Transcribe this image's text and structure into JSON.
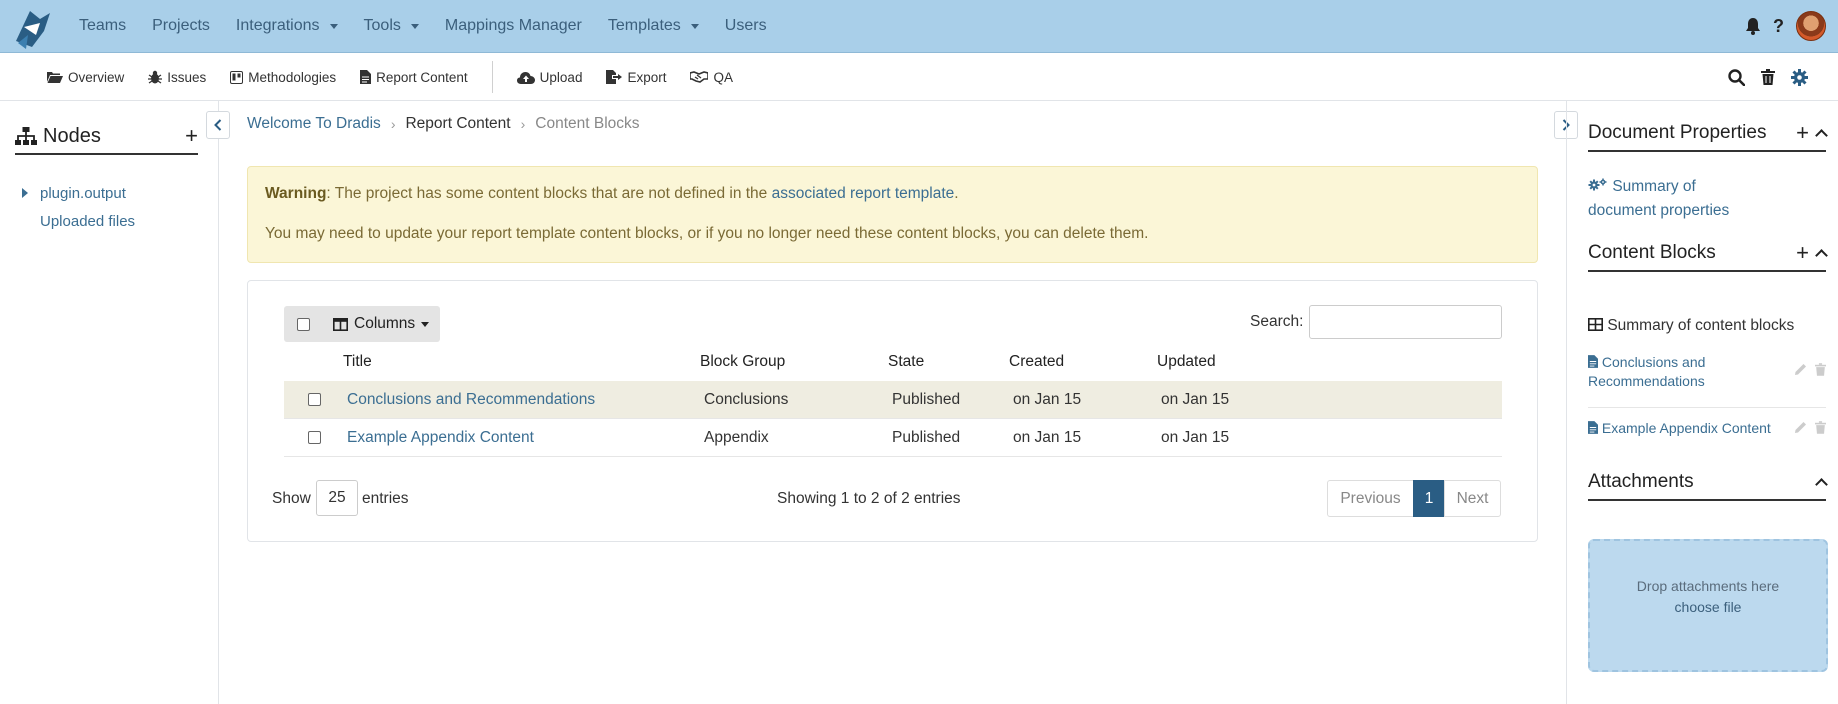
{
  "topnav": {
    "items": [
      {
        "label": "Teams",
        "dropdown": false
      },
      {
        "label": "Projects",
        "dropdown": false
      },
      {
        "label": "Integrations",
        "dropdown": true
      },
      {
        "label": "Tools",
        "dropdown": true
      },
      {
        "label": "Mappings Manager",
        "dropdown": false
      },
      {
        "label": "Templates",
        "dropdown": true
      },
      {
        "label": "Users",
        "dropdown": false
      }
    ],
    "help_label": "?"
  },
  "subnav": {
    "overview": "Overview",
    "issues": "Issues",
    "methodologies": "Methodologies",
    "report_content": "Report Content",
    "upload": "Upload",
    "export": "Export",
    "qa": "QA"
  },
  "left_sidebar": {
    "title": "Nodes",
    "add": "+",
    "items": [
      "plugin.output",
      "Uploaded files"
    ]
  },
  "breadcrumb": {
    "items": [
      "Welcome To Dradis",
      "Report Content",
      "Content Blocks"
    ]
  },
  "alert": {
    "strong": "Warning",
    "text_before": ": The project has some content blocks that are not defined in the ",
    "link": "associated report template",
    "text_after": ".",
    "line2": "You may need to update your report template content blocks, or if you no longer need these content blocks, you can delete them."
  },
  "table": {
    "columns_label": "Columns",
    "search_label": "Search:",
    "headers": [
      "Title",
      "Block Group",
      "State",
      "Created",
      "Updated"
    ],
    "rows": [
      {
        "title": "Conclusions and Recommendations",
        "group": "Conclusions",
        "state": "Published",
        "created": "on Jan 15",
        "updated": "on Jan 15"
      },
      {
        "title": "Example Appendix Content",
        "group": "Appendix",
        "state": "Published",
        "created": "on Jan 15",
        "updated": "on Jan 15"
      }
    ],
    "show_label": "Show",
    "page_size": "25",
    "entries_label": "entries",
    "info": "Showing 1 to 2 of 2 entries",
    "prev": "Previous",
    "page": "1",
    "next": "Next"
  },
  "right_sidebar": {
    "doc_props_title": "Document Properties",
    "doc_props_link_line1": "Summary of",
    "doc_props_link_line2": "document properties",
    "content_blocks_title": "Content Blocks",
    "content_blocks_summary": "Summary of content blocks",
    "blocks": [
      {
        "line1": "Conclusions and",
        "line2": "Recommendations"
      },
      {
        "line1": "Example Appendix Content",
        "line2": ""
      }
    ],
    "attachments_title": "Attachments",
    "drop_text": "Drop attachments here",
    "choose_file": "choose file"
  },
  "colors": {
    "topnav_bg": "#a9cfe9",
    "link": "#3b6e92",
    "warning_bg": "#fbf6d7",
    "row_highlight": "#efede1",
    "pager_active": "#2a5d84",
    "dropzone_bg": "#bcd9ee"
  }
}
